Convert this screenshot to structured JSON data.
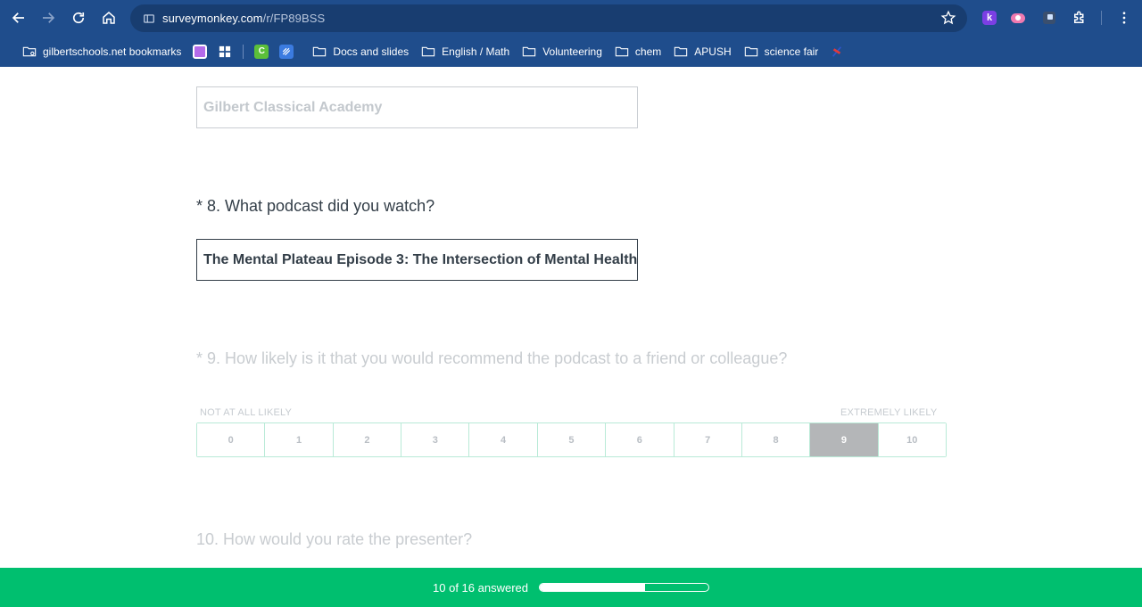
{
  "browser": {
    "url_host": "surveymonkey.com",
    "url_path": "/r/FP89BSS",
    "extensions": [
      "k-extension-icon",
      "camera-extension-icon",
      "square-extension-icon",
      "puzzle-icon"
    ]
  },
  "bookmarks": {
    "items": [
      {
        "type": "folder",
        "label": "gilbertschools.net bookmarks"
      },
      {
        "type": "icon",
        "label": ""
      },
      {
        "type": "icon",
        "label": ""
      },
      {
        "type": "icon",
        "label": "C"
      },
      {
        "type": "icon",
        "label": ""
      },
      {
        "type": "folder",
        "label": "Docs and slides"
      },
      {
        "type": "folder",
        "label": "English / Math"
      },
      {
        "type": "folder",
        "label": "Volunteering"
      },
      {
        "type": "folder",
        "label": "chem"
      },
      {
        "type": "folder",
        "label": "APUSH"
      },
      {
        "type": "folder",
        "label": "science fair"
      }
    ]
  },
  "survey": {
    "q7_answer": "Gilbert Classical Academy",
    "q8_text": "* 8. What podcast did you watch?",
    "q8_answer": "The Mental Plateau Episode 3: The Intersection of Mental Health",
    "q9_text": "* 9. How likely is it that you would recommend the podcast to a friend or colleague?",
    "q9_low_label": "NOT AT ALL LIKELY",
    "q9_high_label": "EXTREMELY LIKELY",
    "q9_options": [
      "0",
      "1",
      "2",
      "3",
      "4",
      "5",
      "6",
      "7",
      "8",
      "9",
      "10"
    ],
    "q9_selected": "9",
    "q10_text": "10. How would you rate the presenter?"
  },
  "progress": {
    "text": "10 of 16 answered",
    "answered": 10,
    "total": 16,
    "fraction": 0.625
  },
  "colors": {
    "chrome": "#1f4d8c",
    "progress_green": "#00bf6f",
    "scale_border": "#b9ead7",
    "selected_cell": "#b4b6b8"
  }
}
